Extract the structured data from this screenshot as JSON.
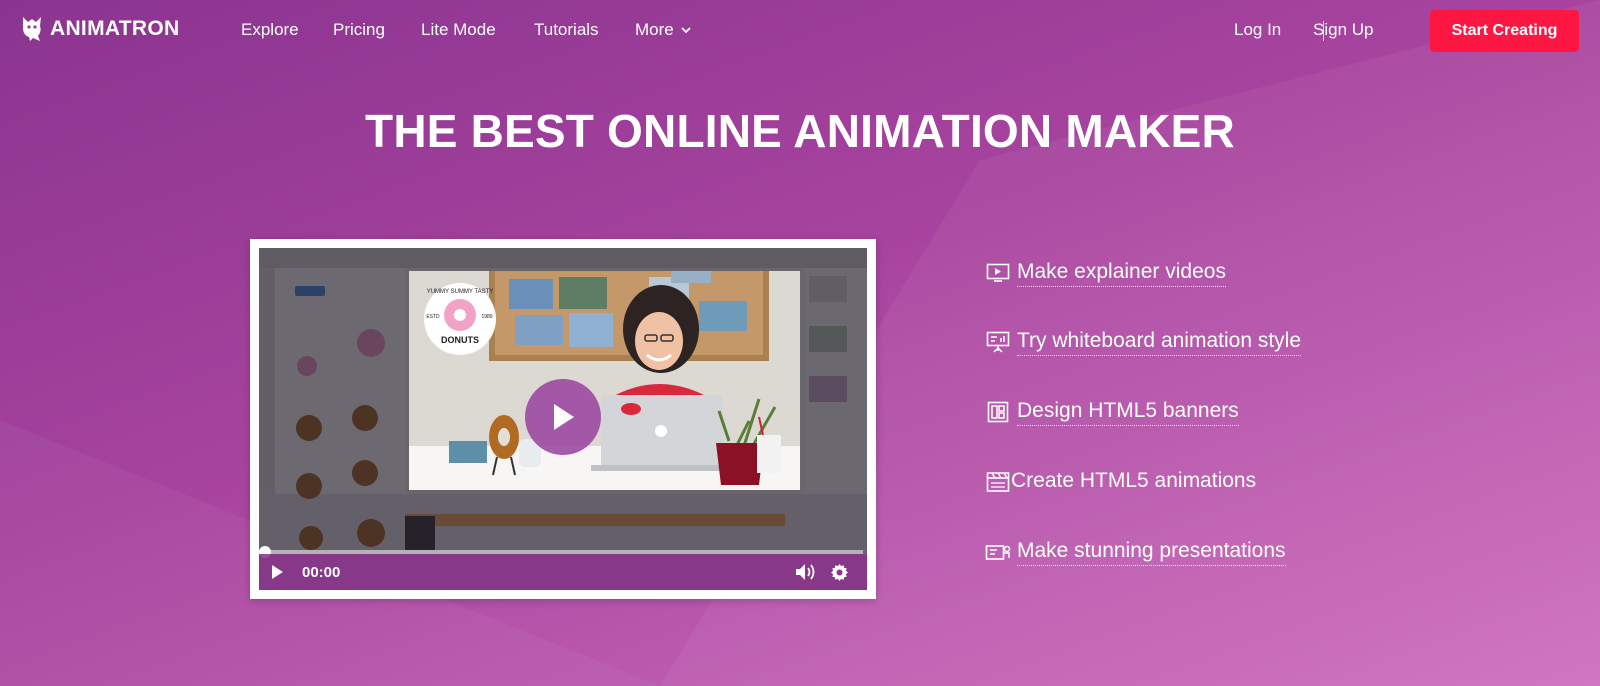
{
  "brand": {
    "name": "ANIMATRON",
    "accent": "#ff1744",
    "background": "#9a3d98"
  },
  "nav": {
    "links": [
      "Explore",
      "Pricing",
      "Lite Mode",
      "Tutorials",
      "More"
    ],
    "login": "Log In",
    "signup": "Sign Up",
    "cta": "Start Creating"
  },
  "hero": {
    "title": "THE BEST ONLINE ANIMATION MAKER"
  },
  "video": {
    "time": "00:00",
    "progress": 0,
    "sign_text": "DONUTS",
    "sign_small": "YUMMY SUMMY TASTY",
    "sign_left": "ESTD",
    "sign_right": "1989"
  },
  "features": [
    {
      "label": "Make explainer videos",
      "icon": "play-screen-icon",
      "linked": true
    },
    {
      "label": "Try whiteboard animation style",
      "icon": "whiteboard-icon",
      "linked": true
    },
    {
      "label": "Design HTML5 banners",
      "icon": "banner-layout-icon",
      "linked": true
    },
    {
      "label": "Create HTML5 animations",
      "icon": "clapperboard-icon",
      "linked": false
    },
    {
      "label": "Make stunning presentations",
      "icon": "presentation-icon",
      "linked": true
    }
  ]
}
